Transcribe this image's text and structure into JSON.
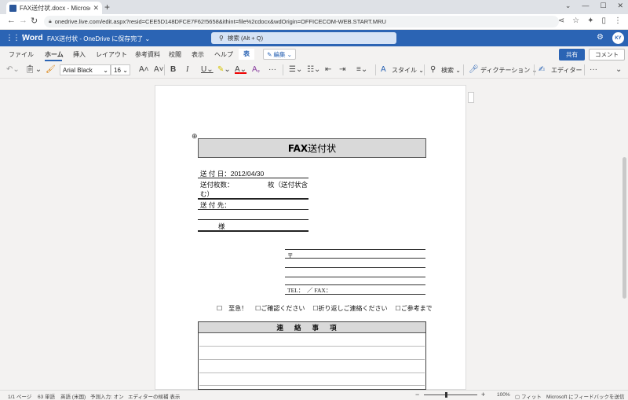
{
  "browser": {
    "tab_title": "FAX送付状.docx - Microsoft Wo",
    "new_tab": "+",
    "url": "onedrive.live.com/edit.aspx?resid=CEE5D148DFCE7F62!5658&ithint=file%2cdocx&wdOrigin=OFFICECOM-WEB.START.MRU"
  },
  "office": {
    "app_name": "Word",
    "doc_name": "FAX送付状 - OneDrive に保存完了 ⌄",
    "search_placeholder": "検索 (Alt + Q)",
    "avatar_initials": "KY"
  },
  "ribbon": {
    "tabs": [
      "ファイル",
      "ホーム",
      "挿入",
      "レイアウト",
      "参考資料",
      "校閲",
      "表示",
      "ヘルプ",
      "表"
    ],
    "edit_mode": "✎ 編集 ⌄",
    "share": "共有",
    "comment": "コメント"
  },
  "toolbar": {
    "font_name": "Arial Black",
    "font_size": "16",
    "style_label": "スタイル",
    "find_label": "検索",
    "dictation_label": "ディクテーション",
    "editor_label": "エディター"
  },
  "document": {
    "title_bold": "FAX",
    "title_rest": "送付状",
    "send_date": "送 付 日：2012/04/30",
    "pages_label": "送付枚数：",
    "pages_suffix": "枚（送付状含",
    "pages_suffix2": "む）",
    "recipient": "送 付 先：",
    "sama": "様",
    "postal": "〒",
    "tel_fax": "TEL：　／ FAX：",
    "checks": [
      "☐　至急！",
      "☐ご確認ください",
      "☐折り返しご連絡ください",
      "☐ご参考まで"
    ],
    "contact_header": "連絡事項"
  },
  "status": {
    "page": "1/1 ページ",
    "words": "63 単語",
    "language": "英語 (米国)",
    "predict": "予測入力: オン",
    "editor_suggest": "エディターの候補 表示",
    "zoom": "100%",
    "fit": "フィット",
    "feedback": "Microsoft にフィードバックを送信"
  }
}
